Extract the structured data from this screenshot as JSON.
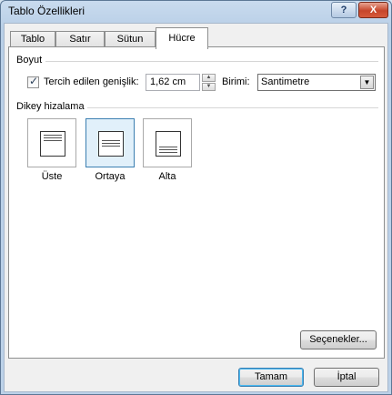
{
  "window": {
    "title": "Tablo Özellikleri",
    "help_label": "?",
    "close_label": "X"
  },
  "tabs": [
    {
      "label": "Tablo"
    },
    {
      "label": "Satır"
    },
    {
      "label": "Sütun"
    },
    {
      "label": "Hücre",
      "active": true
    }
  ],
  "boyut": {
    "group_label": "Boyut",
    "preferred_width_checked": true,
    "preferred_width_label": "Tercih edilen genişlik:",
    "width_value": "1,62 cm",
    "unit_label": "Birimi:",
    "unit_value": "Santimetre"
  },
  "vertical": {
    "group_label": "Dikey hizalama",
    "options": [
      {
        "label": "Üste"
      },
      {
        "label": "Ortaya",
        "selected": true
      },
      {
        "label": "Alta"
      }
    ]
  },
  "buttons": {
    "options": "Seçenekler...",
    "ok": "Tamam",
    "cancel": "İptal"
  }
}
